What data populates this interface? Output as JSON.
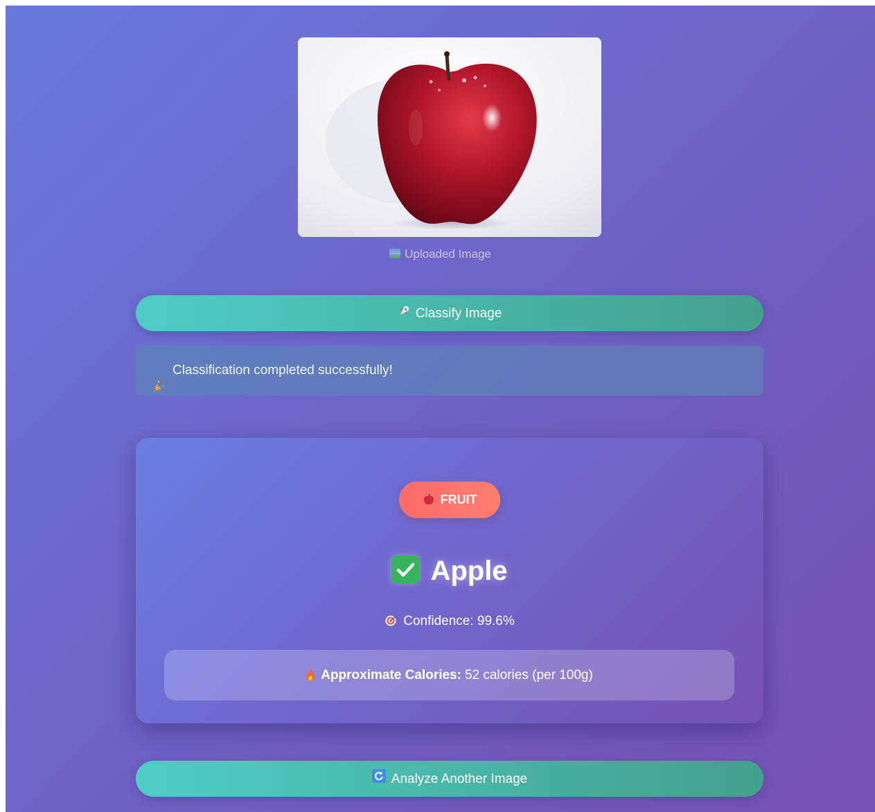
{
  "uploaded_image": {
    "caption": "Uploaded Image",
    "caption_icon": "framed-picture-icon",
    "image_icon": "red-apple-photo"
  },
  "classify_button": {
    "label": "Classify Image",
    "icon": "rocket-icon"
  },
  "status": {
    "message": "Classification completed successfully!",
    "icon": "party-popper-icon"
  },
  "result": {
    "category_badge": "FRUIT",
    "category_icon": "apple-icon",
    "label": "Apple",
    "label_icon": "check-mark-icon",
    "confidence_text": "Confidence: 99.6%",
    "confidence_icon": "target-icon",
    "calories_label": "Approximate Calories:",
    "calories_value": "52 calories (per 100g)",
    "calories_icon": "fire-icon"
  },
  "analyze_button": {
    "label": "Analyze Another Image",
    "icon": "refresh-icon"
  },
  "colors": {
    "background_start": "#667eea",
    "background_end": "#764ba2",
    "button_start": "#4ecdc4",
    "button_end": "#44a08d",
    "badge": "#ff6b6b",
    "success_check": "#35b45a"
  }
}
